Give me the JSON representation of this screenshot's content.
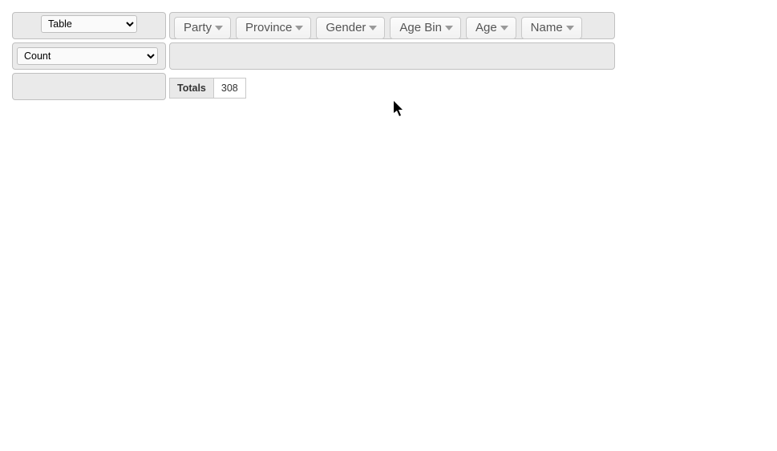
{
  "renderer": {
    "selected": "Table"
  },
  "aggregator": {
    "selected": "Count"
  },
  "unused_attrs": [
    {
      "label": "Party"
    },
    {
      "label": "Province"
    },
    {
      "label": "Gender"
    },
    {
      "label": "Age Bin"
    },
    {
      "label": "Age"
    },
    {
      "label": "Name"
    }
  ],
  "totals": {
    "label": "Totals",
    "value": "308"
  }
}
